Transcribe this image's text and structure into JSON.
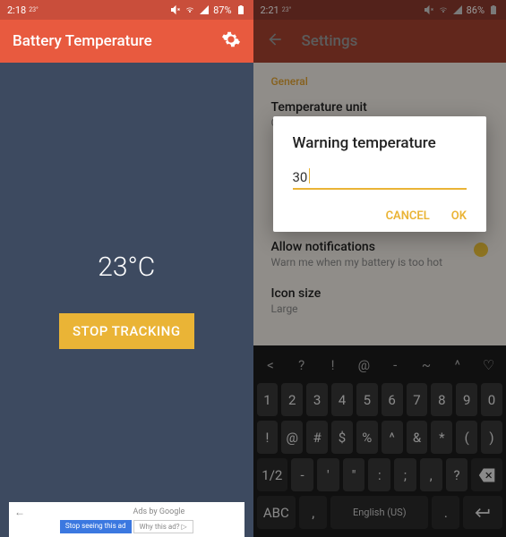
{
  "left": {
    "status": {
      "time": "2:18",
      "deg": "23°",
      "battery": "87%"
    },
    "title": "Battery Temperature",
    "temperature": "23°C",
    "stop_button": "STOP TRACKING",
    "ad": {
      "title": "Ads by Google",
      "btn1": "Stop seeing this ad",
      "btn2": "Why this ad? ▷"
    }
  },
  "right": {
    "status": {
      "time": "2:21",
      "deg": "23°",
      "battery": "86%"
    },
    "title": "Settings",
    "section": "General",
    "items": [
      {
        "title": "Temperature unit",
        "sub": "Celsius"
      },
      {
        "title": "Allow notifications",
        "sub": "Warn me when my battery is too hot"
      },
      {
        "title": "Icon size",
        "sub": "Large"
      }
    ],
    "dialog": {
      "title": "Warning temperature",
      "value": "30",
      "cancel": "CANCEL",
      "ok": "OK"
    },
    "keyboard": {
      "row0": [
        "<",
        "?",
        "!",
        "@",
        "-",
        "~",
        "^",
        "♡"
      ],
      "row1": [
        "1",
        "2",
        "3",
        "4",
        "5",
        "6",
        "7",
        "8",
        "9",
        "0"
      ],
      "row2": [
        "!",
        "@",
        "#",
        "$",
        "%",
        "^",
        "&",
        "*",
        "(",
        ")"
      ],
      "row3_left": "1/2",
      "row3": [
        "-",
        "'",
        "\"",
        ":",
        ";",
        ",",
        "?"
      ],
      "row3_right": "⌫",
      "row4": {
        "abc": "ABC",
        "comma": ",",
        "space": "English (US)",
        "dot": ".",
        "enter": "↵"
      }
    }
  }
}
